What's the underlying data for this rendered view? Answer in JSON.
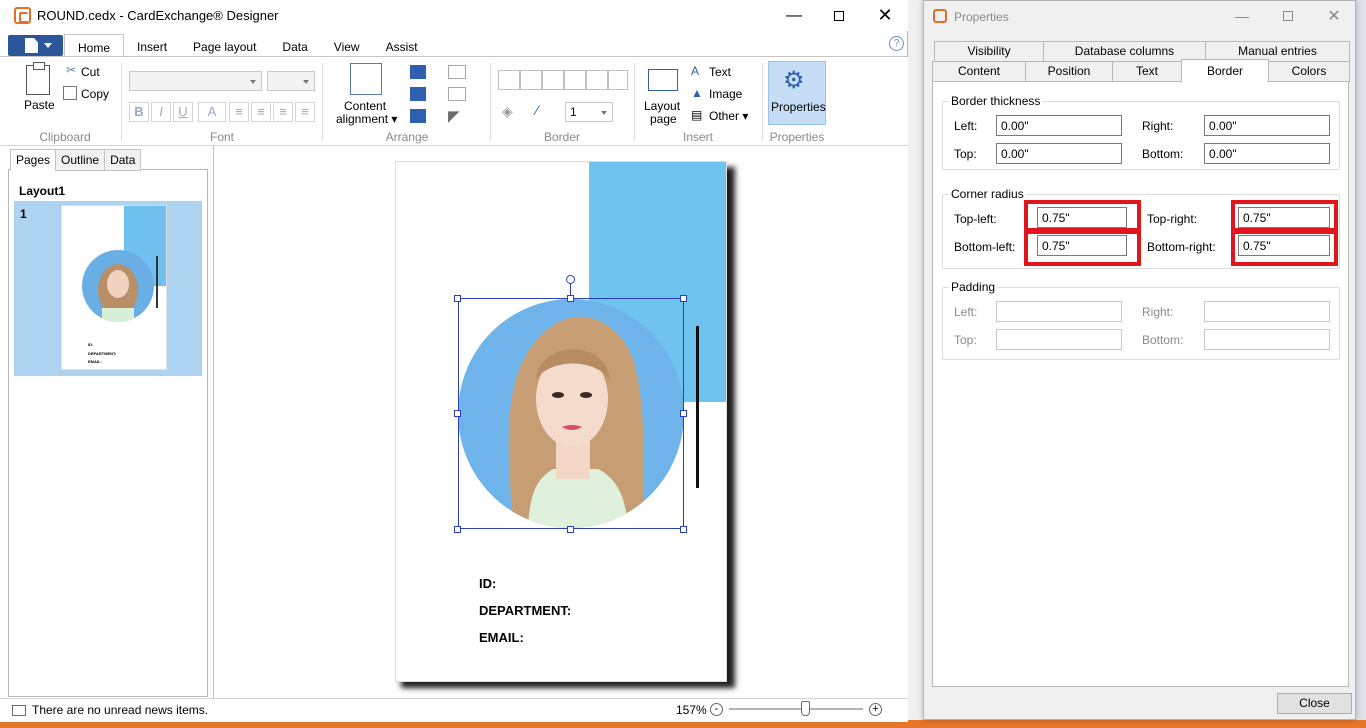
{
  "main_window": {
    "title": "ROUND.cedx - CardExchange® Designer",
    "tabs": [
      "Home",
      "Insert",
      "Page layout",
      "Data",
      "View",
      "Assist"
    ],
    "help": "?"
  },
  "ribbon": {
    "clipboard": {
      "paste": "Paste",
      "cut": "Cut",
      "copy": "Copy",
      "label": "Clipboard"
    },
    "font": {
      "label": "Font",
      "bold": "B",
      "italic": "I",
      "underline": "U",
      "color": "A"
    },
    "arrange": {
      "content_alignment_1": "Content",
      "content_alignment_2": "alignment ▾",
      "label": "Arrange"
    },
    "border": {
      "width_value": "1",
      "label": "Border"
    },
    "insert": {
      "layout_page_1": "Layout",
      "layout_page_2": "page",
      "text": "Text",
      "image": "Image",
      "other": "Other ▾",
      "label": "Insert"
    },
    "properties": {
      "button": "Properties",
      "label": "Properties"
    }
  },
  "left_panel": {
    "tabs": [
      "Pages",
      "Outline",
      "Data"
    ],
    "layout_title": "Layout1",
    "page_number": "1",
    "thumb_labels": [
      "ID:",
      "DEPARTMENT:",
      "EMAIL:"
    ]
  },
  "card": {
    "labels": [
      "ID:",
      "DEPARTMENT:",
      "EMAIL:"
    ],
    "accent_color": "#6ec3ef"
  },
  "status": {
    "news": "There are no unread news items.",
    "zoom": "157%",
    "zoom_minus": "-",
    "zoom_plus": "+"
  },
  "properties_window": {
    "title": "Properties",
    "tabs_row1": [
      "Visibility",
      "Database columns",
      "Manual entries"
    ],
    "tabs_row2": [
      "Content",
      "Position",
      "Text",
      "Border",
      "Colors"
    ],
    "active_tab": "Border",
    "border_thickness": {
      "legend": "Border thickness",
      "left_label": "Left:",
      "left": "0.00\"",
      "right_label": "Right:",
      "right": "0.00\"",
      "top_label": "Top:",
      "top": "0.00\"",
      "bottom_label": "Bottom:",
      "bottom": "0.00\""
    },
    "corner_radius": {
      "legend": "Corner radius",
      "top_left_label": "Top-left:",
      "top_left": "0.75\"",
      "top_right_label": "Top-right:",
      "top_right": "0.75\"",
      "bottom_left_label": "Bottom-left:",
      "bottom_left": "0.75\"",
      "bottom_right_label": "Bottom-right:",
      "bottom_right": "0.75\""
    },
    "padding": {
      "legend": "Padding",
      "left_label": "Left:",
      "right_label": "Right:",
      "top_label": "Top:",
      "bottom_label": "Bottom:"
    },
    "close": "Close"
  }
}
